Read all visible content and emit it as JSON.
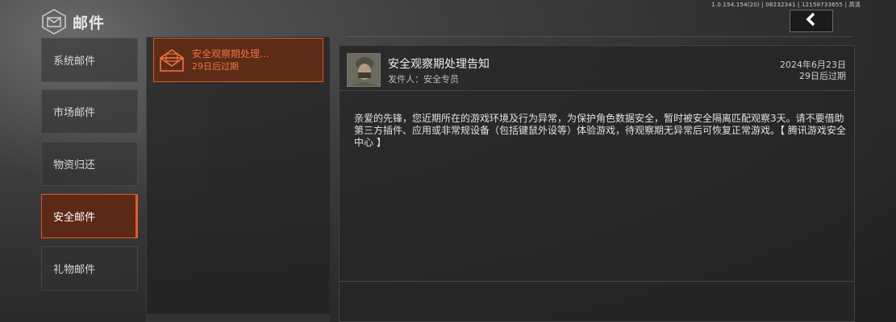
{
  "header": {
    "title": "邮件",
    "build_info": "1.0.154.154(20) | 06232341 | 12158733655 | 高清",
    "back_icon": "chevron-left-icon"
  },
  "sidebar": {
    "items": [
      {
        "label": "系统邮件",
        "active": false
      },
      {
        "label": "市场邮件",
        "active": false
      },
      {
        "label": "物资归还",
        "active": false
      },
      {
        "label": "安全邮件",
        "active": true
      },
      {
        "label": "礼物邮件",
        "active": false
      }
    ]
  },
  "mail_list": {
    "items": [
      {
        "subject": "安全观察期处理...",
        "expiry": "29日后过期",
        "icon": "envelope-icon"
      }
    ]
  },
  "detail": {
    "title": "安全观察期处理告知",
    "sender_label": "发件人：安全专员",
    "date": "2024年6月23日",
    "remaining": "29日后过期",
    "body": "亲爱的先锋，您近期所在的游戏环境及行为异常，为保护角色数据安全，暂时被安全隔离匹配观察3天。请不要借助第三方插件、应用或非常规设备（包括键鼠外设等）体验游戏，待观察期无异常后可恢复正常游戏。【 腾讯游戏安全中心 】"
  },
  "colors": {
    "accent": "#e75a24",
    "accent_text": "#f0733f",
    "active_bg": "#5b2a16"
  }
}
